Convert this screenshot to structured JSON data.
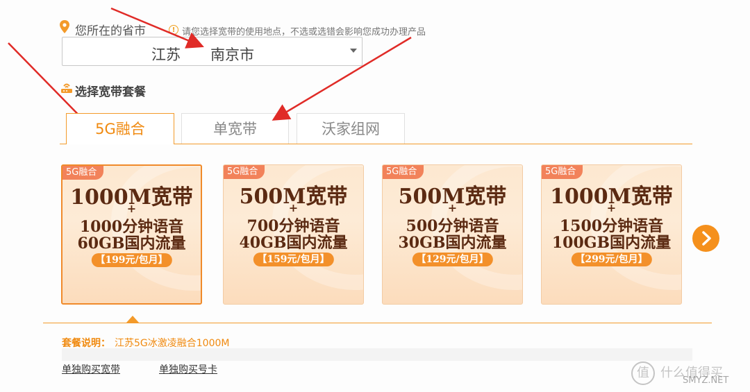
{
  "location": {
    "label": "您所在的省市",
    "tip": "请您选择宽带的使用地点，不选或选错会影响您成功办理产品",
    "province": "江苏",
    "city": "南京市"
  },
  "package_section": {
    "label": "选择宽带套餐"
  },
  "tabs": [
    {
      "label": "5G融合",
      "active": true
    },
    {
      "label": "单宽带",
      "active": false
    },
    {
      "label": "沃家组网",
      "active": false
    }
  ],
  "cards": [
    {
      "tag": "5G融合",
      "speed": "1000M宽带",
      "plus": "+",
      "voice": "1000分钟语音",
      "data": "60GB国内流量",
      "price": "【199元/包月】",
      "selected": true
    },
    {
      "tag": "5G融合",
      "speed": "500M宽带",
      "plus": "+",
      "voice": "700分钟语音",
      "data": "40GB国内流量",
      "price": "【159元/包月】",
      "selected": false
    },
    {
      "tag": "5G融合",
      "speed": "500M宽带",
      "plus": "+",
      "voice": "500分钟语音",
      "data": "30GB国内流量",
      "price": "【129元/包月】",
      "selected": false
    },
    {
      "tag": "5G融合",
      "speed": "1000M宽带",
      "plus": "+",
      "voice": "1500分钟语音",
      "data": "100GB国内流量",
      "price": "【299元/包月】",
      "selected": false
    }
  ],
  "description": {
    "label": "套餐说明：",
    "text": "江苏5G冰激凌融合1000M"
  },
  "links": {
    "buy_broadband": "单独购买宽带",
    "buy_number": "单独购买号卡"
  },
  "watermark": {
    "logo": "值",
    "text": "什么值得买",
    "sub": "SMYZ.NET"
  },
  "colors": {
    "accent": "#f39a2a",
    "tag": "#f2825a",
    "card_text": "#5b2a12",
    "annotation_arrow": "#e02b27"
  },
  "icons": {
    "location": "map-pin-icon",
    "tip": "info-icon",
    "package": "router-icon",
    "next": "chevron-right-icon",
    "dropdown": "chevron-down-icon"
  }
}
